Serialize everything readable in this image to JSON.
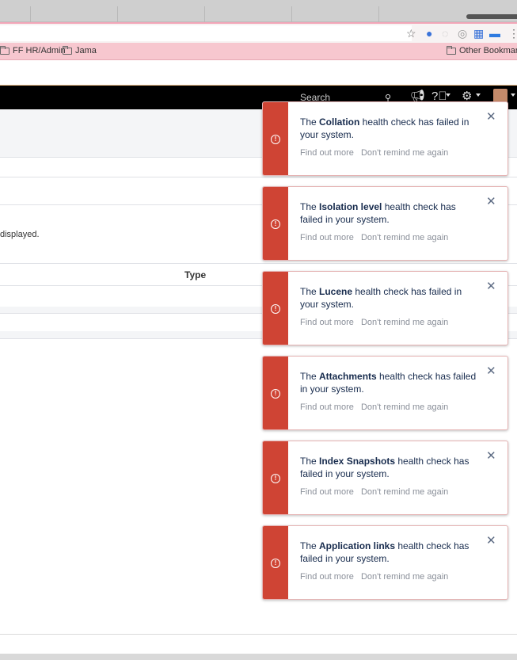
{
  "browser": {
    "bookmarks": [
      "FF HR/Admin",
      "Jama"
    ],
    "other_bookmarks": "Other Bookmark"
  },
  "header": {
    "search_placeholder": "Search"
  },
  "page": {
    "partial_text": "displayed.",
    "column_type": "Type"
  },
  "flags": [
    {
      "prefix": "The ",
      "name": "Collation",
      "suffix": " health check has failed in your system.",
      "find_out_more": "Find out more",
      "dont_remind": "Don't remind me again"
    },
    {
      "prefix": "The ",
      "name": "Isolation level",
      "suffix": " health check has failed in your system.",
      "find_out_more": "Find out more",
      "dont_remind": "Don't remind me again"
    },
    {
      "prefix": "The ",
      "name": "Lucene",
      "suffix": " health check has failed in your system.",
      "find_out_more": "Find out more",
      "dont_remind": "Don't remind me again"
    },
    {
      "prefix": "The ",
      "name": "Attachments",
      "suffix": " health check has failed in your system.",
      "find_out_more": "Find out more",
      "dont_remind": "Don't remind me again"
    },
    {
      "prefix": "The ",
      "name": "Index Snapshots",
      "suffix": " health check has failed in your system.",
      "find_out_more": "Find out more",
      "dont_remind": "Don't remind me again"
    },
    {
      "prefix": "The ",
      "name": "Application links",
      "suffix": " health check has failed in your system.",
      "find_out_more": "Find out more",
      "dont_remind": "Don't remind me again"
    }
  ],
  "colors": {
    "flag_error": "#cf4434",
    "header_bg": "#000000",
    "bookmarks_bg": "#f7c7cf"
  }
}
